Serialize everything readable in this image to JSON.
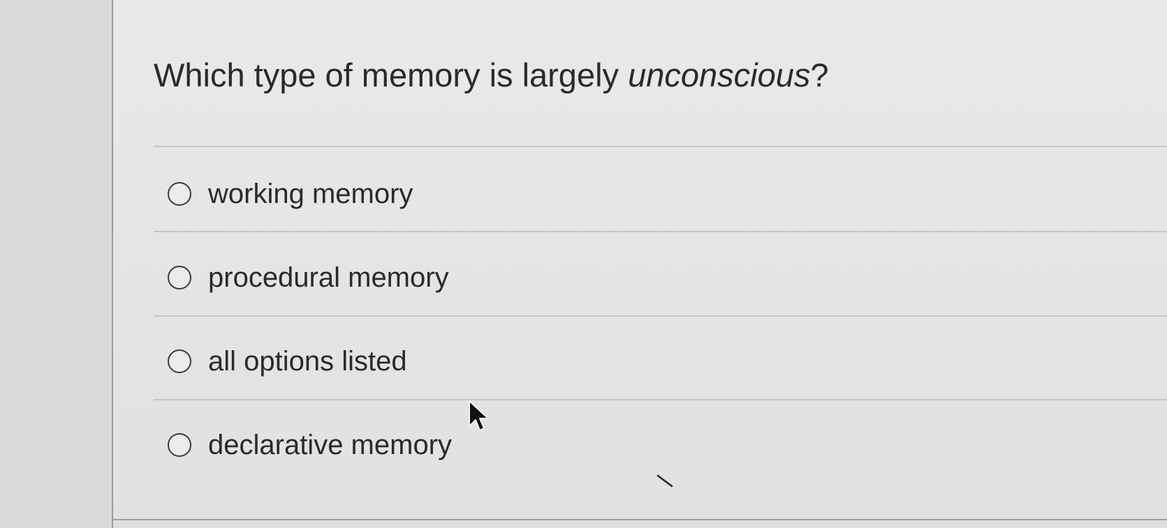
{
  "question": {
    "text_before": "Which type of memory is largely ",
    "text_emphasis": "unconscious",
    "text_after": "?"
  },
  "options": [
    {
      "label": "working memory",
      "selected": false
    },
    {
      "label": "procedural memory",
      "selected": false
    },
    {
      "label": "all options listed",
      "selected": false
    },
    {
      "label": "declarative memory",
      "selected": false
    }
  ],
  "colors": {
    "background": "#e6e6e6",
    "text": "#2a2a2a",
    "separator": "#c6c6c6",
    "gutter_border": "#9a9a9a"
  },
  "icons": {
    "radio": "radio-unchecked-icon",
    "pointer": "mouse-pointer-icon"
  }
}
